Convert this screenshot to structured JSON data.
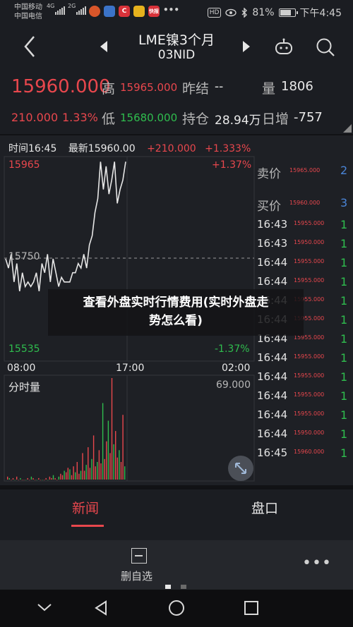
{
  "status_bar": {
    "carrier1": "中国移动",
    "carrier2": "中国电信",
    "net1": "4G",
    "net2": "2G",
    "hd": "HD",
    "battery_pct": "81%",
    "battery_level": 0.81,
    "time": "下午4:45",
    "app_icons": [
      "bird-app-icon",
      "weather-app-icon",
      "c-app-icon",
      "game-app-icon",
      "kuaibao-app-icon",
      "more-dots-icon"
    ],
    "app_labels": [
      "",
      "",
      "C",
      "",
      "快报",
      ""
    ]
  },
  "header": {
    "title": "LME镍3个月",
    "code": "03NID"
  },
  "quote": {
    "price": "15960.000",
    "high_label": "高",
    "high": "15965.000",
    "prev_close_label": "昨结",
    "prev_close": "--",
    "volume_label": "量",
    "volume": "1806",
    "change": "210.000",
    "change_pct": "1.33%",
    "low_label": "低",
    "low": "15680.000",
    "oi_label": "持仓",
    "oi": "28.94万",
    "daily_inc_label": "日增",
    "daily_inc": "-757"
  },
  "chart_header": {
    "time": "时间16:45",
    "latest": "最新15960.00",
    "change": "+210.000",
    "change_pct": "+1.333%"
  },
  "chart_data": {
    "type": "line",
    "title": "",
    "y_top": "15965",
    "y_top_pct": "+1.37%",
    "y_mid": "15750",
    "y_bottom": "15535",
    "y_bottom_pct": "-1.37%",
    "ylim": [
      15535,
      15965
    ],
    "x_ticks": [
      "08:00",
      "17:00",
      "02:00"
    ],
    "series": [
      {
        "values": [
          15750,
          15730,
          15760,
          15700,
          15740,
          15680,
          15720,
          15690,
          15700,
          15690,
          15700,
          15720,
          15680,
          15740,
          15720,
          15760,
          15700,
          15750,
          15720,
          15690,
          15710,
          15700,
          15700,
          15700,
          15720,
          15720,
          15740,
          15730,
          15760,
          15730,
          15780,
          15800,
          15850,
          15880,
          15960,
          15900,
          15950,
          15890,
          15920,
          15960,
          15870,
          15900,
          15920,
          15960
        ]
      }
    ],
    "volume_label": "分时量",
    "volume_max": "69.000",
    "volume": [
      2,
      1,
      0,
      1,
      0,
      2,
      0,
      1,
      0,
      0,
      0,
      1,
      0,
      2,
      1,
      0,
      0,
      1,
      0,
      0,
      0,
      1,
      0,
      2,
      1,
      3,
      1,
      0,
      2,
      4,
      3,
      6,
      5,
      8,
      7,
      3,
      9,
      5,
      12,
      4,
      6,
      18,
      6,
      10,
      22,
      8,
      14,
      30,
      9,
      12,
      20,
      11,
      52,
      14,
      26,
      40,
      18,
      69,
      24,
      33,
      15,
      20,
      12,
      44,
      9
    ]
  },
  "side_panel": {
    "ask_label": "卖价",
    "ask_price": "15965.000",
    "ask_vol": "2",
    "bid_label": "买价",
    "bid_price": "15960.000",
    "bid_vol": "3",
    "ticks": [
      {
        "time": "16:43",
        "price": "15955.000",
        "vol": "1"
      },
      {
        "time": "16:43",
        "price": "15950.000",
        "vol": "1"
      },
      {
        "time": "16:44",
        "price": "15955.000",
        "vol": "1"
      },
      {
        "time": "16:44",
        "price": "15955.000",
        "vol": "1"
      },
      {
        "time": "16:44",
        "price": "15955.000",
        "vol": "1"
      },
      {
        "time": "16:44",
        "price": "15955.000",
        "vol": "1"
      },
      {
        "time": "16:44",
        "price": "15955.000",
        "vol": "1"
      },
      {
        "time": "16:44",
        "price": "15955.000",
        "vol": "1"
      },
      {
        "time": "16:44",
        "price": "15955.000",
        "vol": "1"
      },
      {
        "time": "16:44",
        "price": "15955.000",
        "vol": "1"
      },
      {
        "time": "16:44",
        "price": "15955.000",
        "vol": "1"
      },
      {
        "time": "16:44",
        "price": "15950.000",
        "vol": "1"
      },
      {
        "time": "16:45",
        "price": "15960.000",
        "vol": "1"
      }
    ]
  },
  "overlay": {
    "line1": "查看外盘实时行情费用(实时外盘走",
    "line2": "势怎么看)"
  },
  "tabs": {
    "news": "新闻",
    "orderbook": "盘口"
  },
  "toolbar": {
    "delete_label": "删自选"
  },
  "colors": {
    "up": "#e8474d",
    "down": "#2fbd4e",
    "background": "#1b1d22",
    "price_line": "#e6e6e6"
  }
}
